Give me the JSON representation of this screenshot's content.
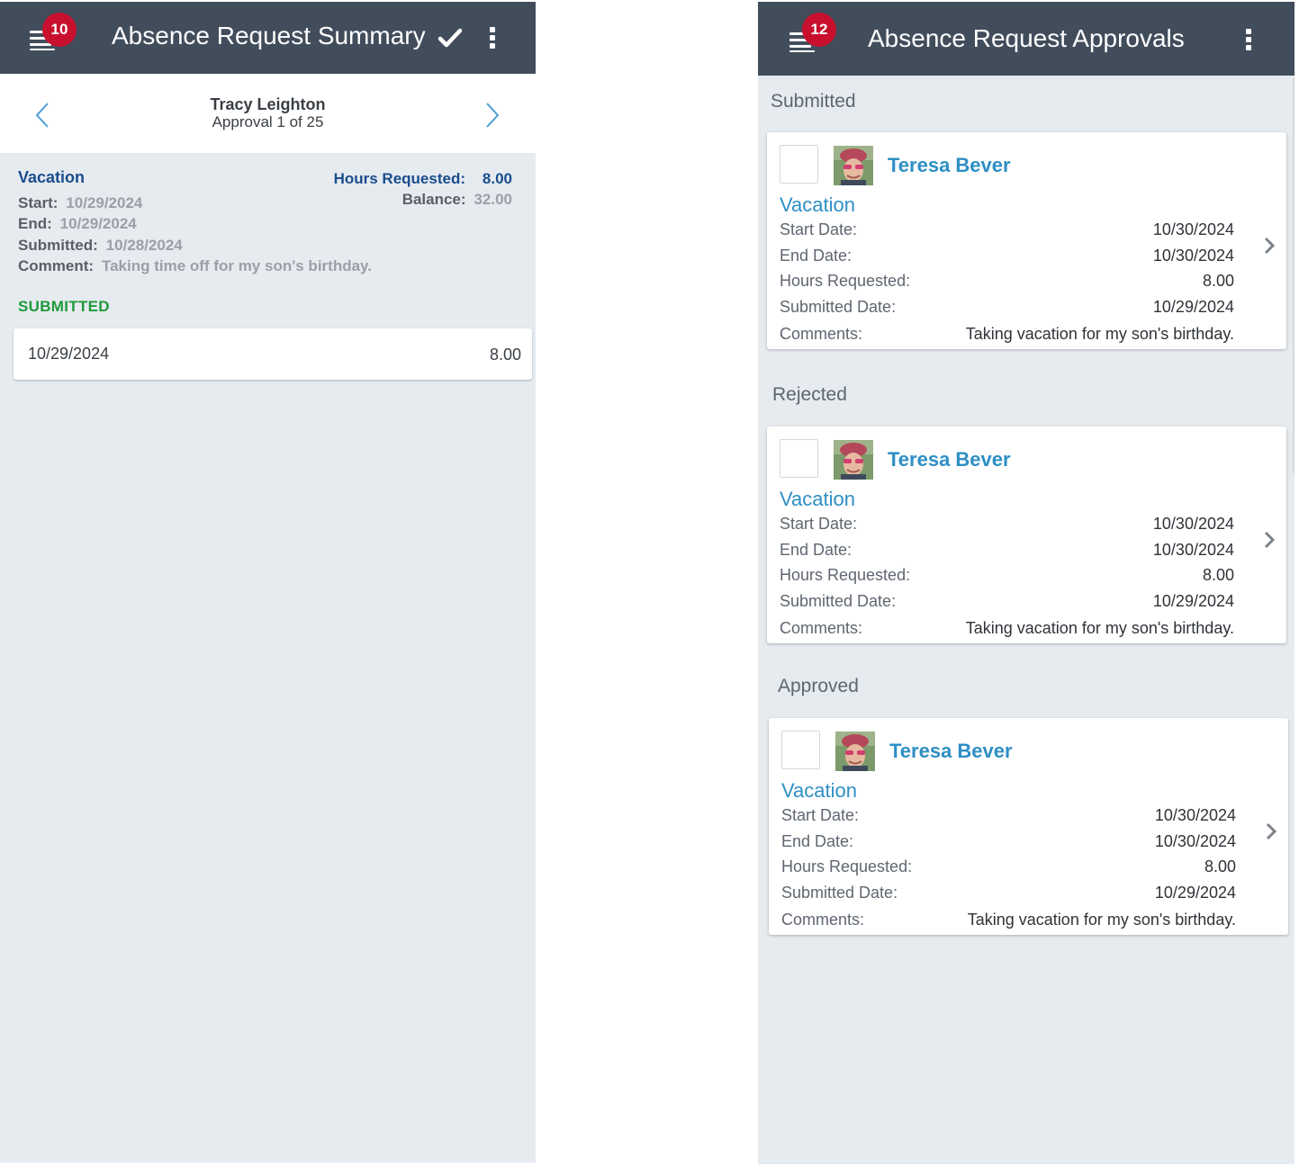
{
  "left": {
    "header": {
      "badge": "10",
      "title": "Absence Request Summary",
      "icons": [
        "hamburger-menu-icon",
        "checkmark-icon",
        "more-vertical-icon"
      ]
    },
    "nav": {
      "employee": "Tracy Leighton",
      "position": "Approval 1 of 25"
    },
    "summary": {
      "type": "Vacation",
      "start_label": "Start:",
      "start": "10/29/2024",
      "end_label": "End:",
      "end": "10/29/2024",
      "submitted_label": "Submitted:",
      "submitted": "10/28/2024",
      "comment_label": "Comment:",
      "comment": "Taking time off for my son's birthday.",
      "hours_label": "Hours Requested:",
      "hours": "8.00",
      "balance_label": "Balance:",
      "balance": "32.00"
    },
    "status": "SUBMITTED",
    "days": [
      {
        "date": "10/29/2024",
        "hours": "8.00"
      }
    ]
  },
  "right": {
    "header": {
      "badge": "12",
      "title": "Absence Request Approvals",
      "icons": [
        "hamburger-menu-icon",
        "more-vertical-icon"
      ]
    },
    "field_labels": {
      "start": "Start Date:",
      "end": "End Date:",
      "hours": "Hours Requested:",
      "submitted": "Submitted Date:",
      "comments": "Comments:"
    },
    "sections": [
      {
        "label": "Submitted",
        "card": {
          "name": "Teresa Bever",
          "type": "Vacation",
          "start": "10/30/2024",
          "end": "10/30/2024",
          "hours": "8.00",
          "submitted": "10/29/2024",
          "comments": "Taking vacation for my son's birthday."
        }
      },
      {
        "label": "Rejected",
        "card": {
          "name": "Teresa Bever",
          "type": "Vacation",
          "start": "10/30/2024",
          "end": "10/30/2024",
          "hours": "8.00",
          "submitted": "10/29/2024",
          "comments": "Taking vacation for my son's birthday."
        }
      },
      {
        "label": "Approved",
        "card": {
          "name": "Teresa Bever",
          "type": "Vacation",
          "start": "10/30/2024",
          "end": "10/30/2024",
          "hours": "8.00",
          "submitted": "10/29/2024",
          "comments": "Taking vacation for my son's birthday."
        }
      }
    ]
  },
  "colors": {
    "header": "#424d5c",
    "badge": "#c8102e",
    "link_blue": "#2e8fc4",
    "title_blue": "#1a4d8c",
    "status_green": "#1f9a3a",
    "background": "#e6ebf0"
  }
}
